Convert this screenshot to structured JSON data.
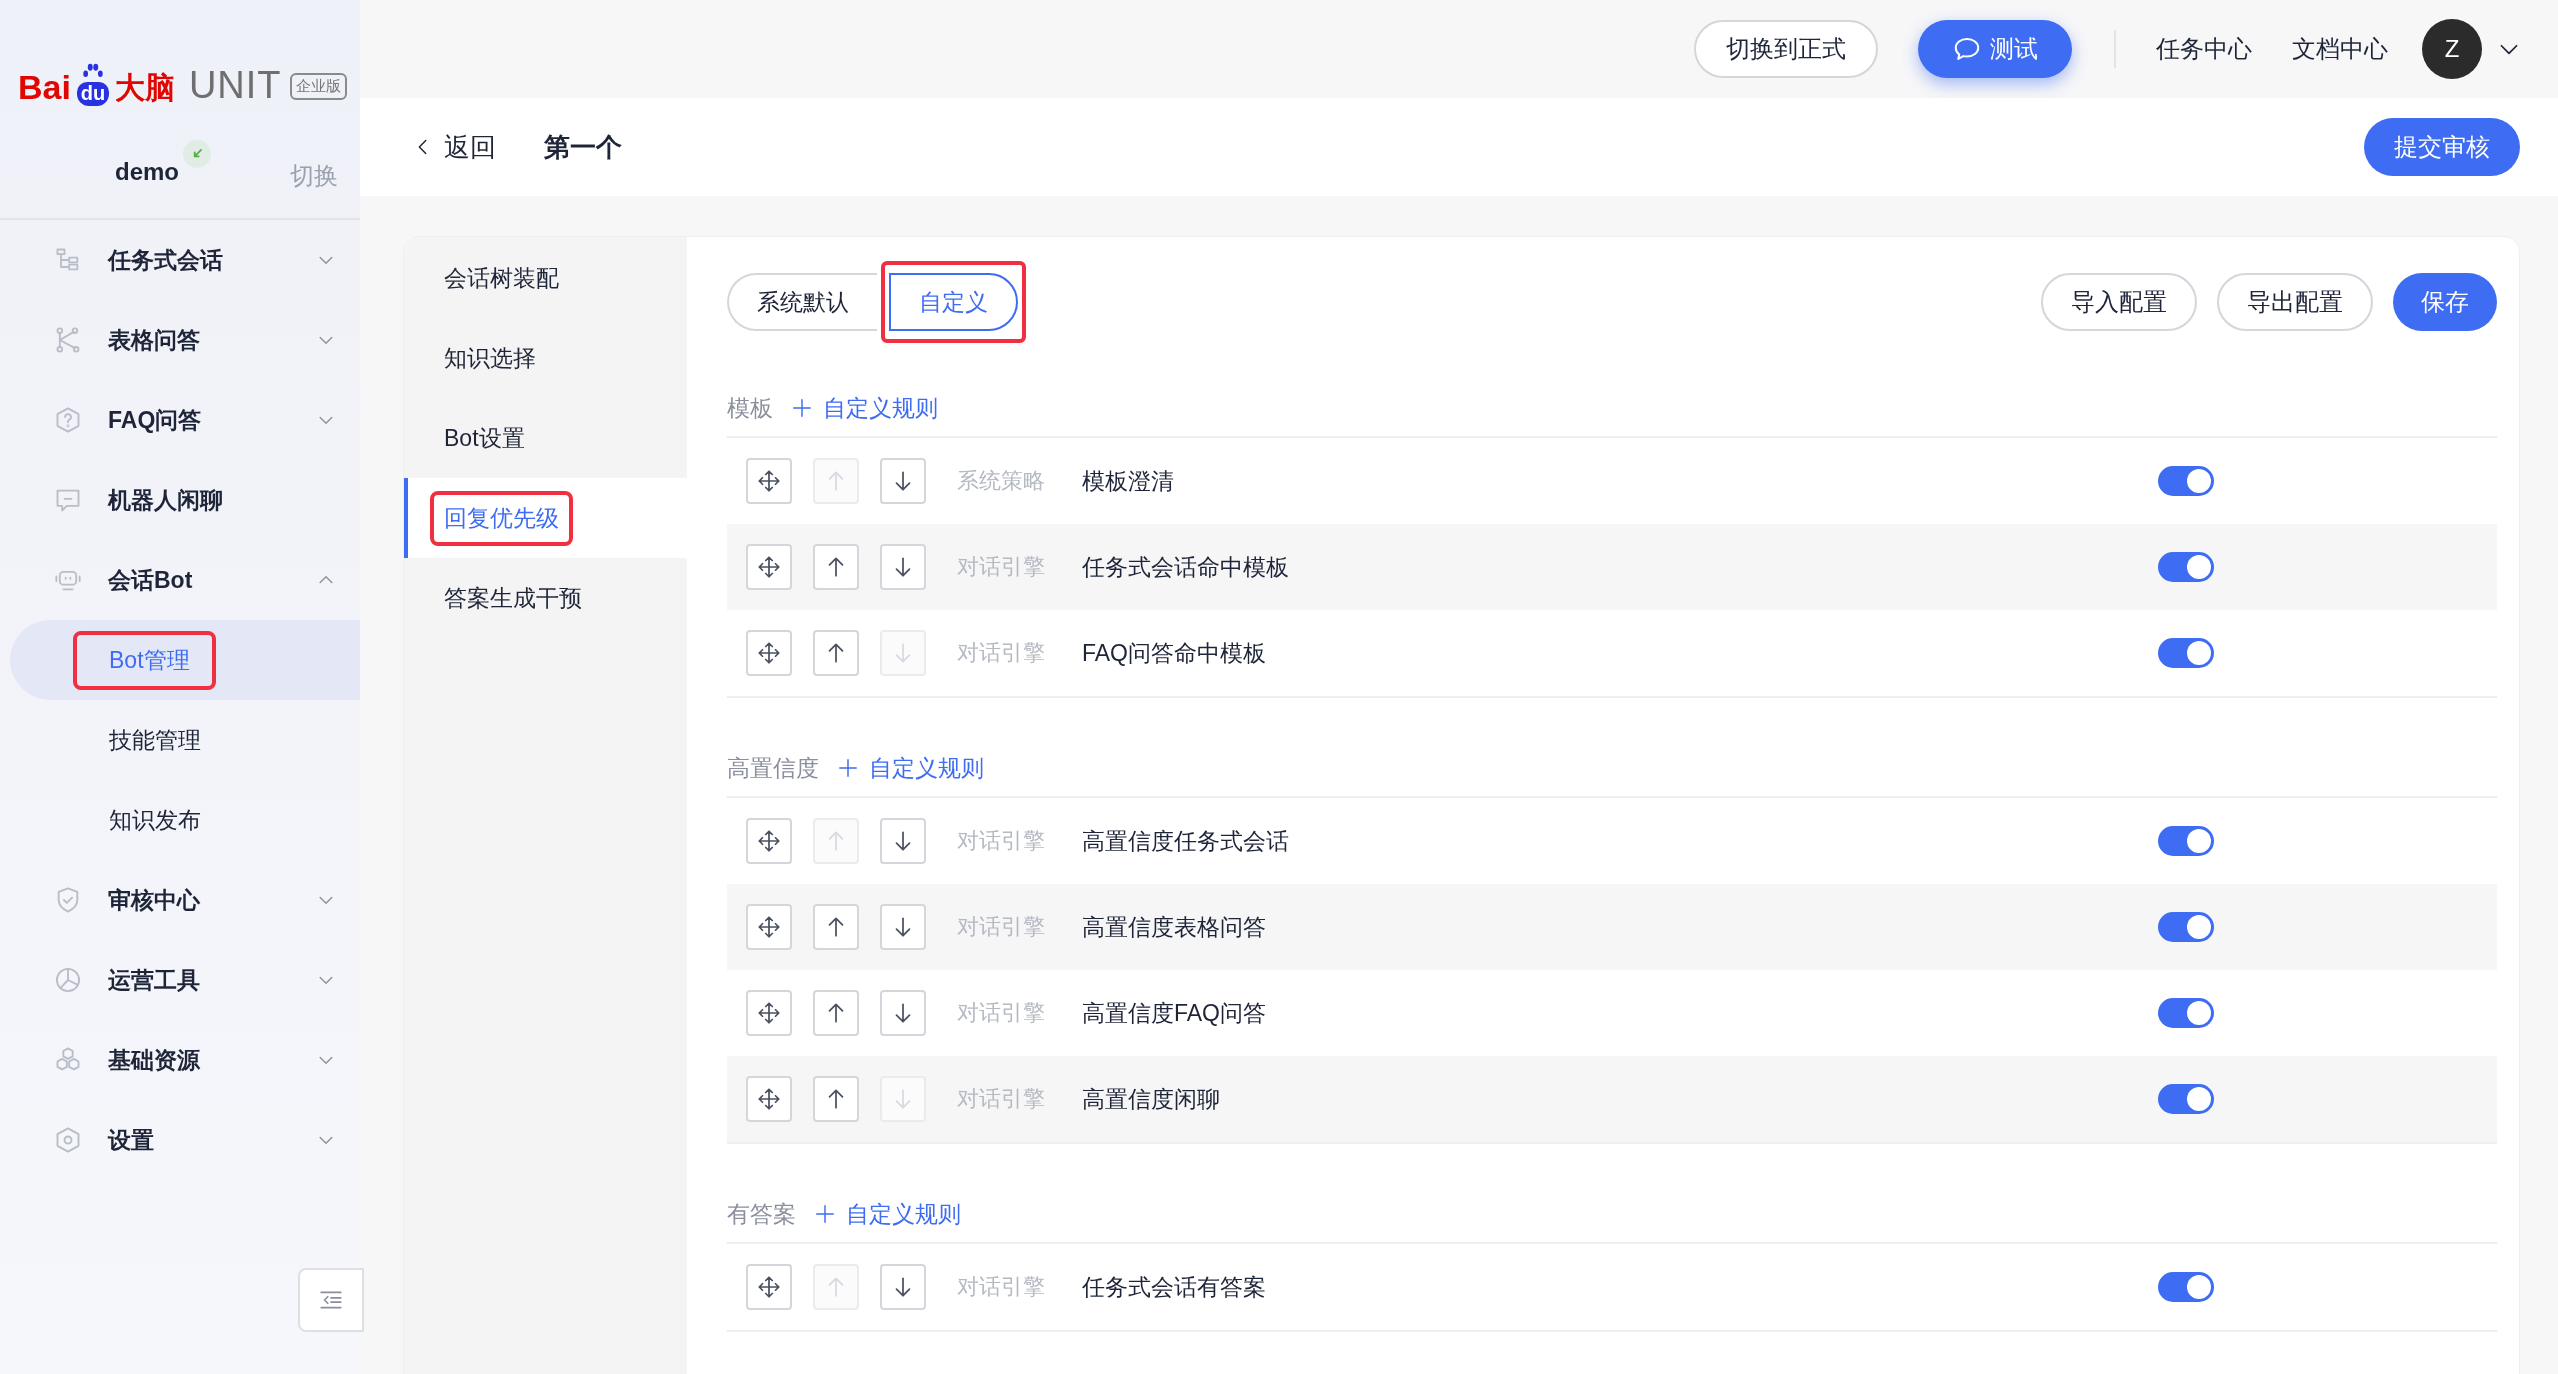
{
  "logo": {
    "brand": "Bai",
    "paw_text": "du",
    "product_cn": "大脑",
    "product": "UNIT",
    "edition": "企业版"
  },
  "account": {
    "name": "demo",
    "switch_label": "切换"
  },
  "sidebar": {
    "items": [
      {
        "label": "任务式会话",
        "expanded": false
      },
      {
        "label": "表格问答",
        "expanded": false
      },
      {
        "label": "FAQ问答",
        "expanded": false
      },
      {
        "label": "机器人闲聊"
      },
      {
        "label": "会话Bot",
        "expanded": true,
        "children": [
          {
            "label": "Bot管理",
            "selected": true,
            "highlighted": true
          },
          {
            "label": "技能管理",
            "selected": false,
            "highlighted": false
          },
          {
            "label": "知识发布",
            "selected": false,
            "highlighted": false
          }
        ]
      },
      {
        "label": "审核中心",
        "expanded": false
      },
      {
        "label": "运营工具",
        "expanded": false
      },
      {
        "label": "基础资源",
        "expanded": false
      },
      {
        "label": "设置",
        "expanded": false
      }
    ]
  },
  "topbar": {
    "switch_button": "切换到正式",
    "test_button": "测试",
    "links": [
      "任务中心",
      "文档中心"
    ],
    "avatar": "Z"
  },
  "header": {
    "back": "返回",
    "title": "第一个",
    "submit_button": "提交审核"
  },
  "settings_nav": [
    {
      "label": "会话树装配",
      "selected": false,
      "highlighted": false
    },
    {
      "label": "知识选择",
      "selected": false,
      "highlighted": false
    },
    {
      "label": "Bot设置",
      "selected": false,
      "highlighted": false
    },
    {
      "label": "回复优先级",
      "selected": true,
      "highlighted": true
    },
    {
      "label": "答案生成干预",
      "selected": false,
      "highlighted": false
    }
  ],
  "mode_tabs": [
    {
      "label": "系统默认",
      "selected": false,
      "highlighted": false
    },
    {
      "label": "自定义",
      "selected": true,
      "highlighted": true
    }
  ],
  "actions": [
    {
      "label": "导入配置",
      "kind": "outline"
    },
    {
      "label": "导出配置",
      "kind": "outline"
    },
    {
      "label": "保存",
      "kind": "primary"
    }
  ],
  "sections": [
    {
      "title": "模板",
      "add_label": "自定义规则",
      "rows": [
        {
          "category": "系统策略",
          "name": "模板澄清",
          "up_disabled": true,
          "down_disabled": false,
          "on": true
        },
        {
          "category": "对话引擎",
          "name": "任务式会话命中模板",
          "up_disabled": false,
          "down_disabled": false,
          "on": true
        },
        {
          "category": "对话引擎",
          "name": "FAQ问答命中模板",
          "up_disabled": false,
          "down_disabled": true,
          "on": true
        }
      ]
    },
    {
      "title": "高置信度",
      "add_label": "自定义规则",
      "rows": [
        {
          "category": "对话引擎",
          "name": "高置信度任务式会话",
          "up_disabled": true,
          "down_disabled": false,
          "on": true
        },
        {
          "category": "对话引擎",
          "name": "高置信度表格问答",
          "up_disabled": false,
          "down_disabled": false,
          "on": true
        },
        {
          "category": "对话引擎",
          "name": "高置信度FAQ问答",
          "up_disabled": false,
          "down_disabled": false,
          "on": true
        },
        {
          "category": "对话引擎",
          "name": "高置信度闲聊",
          "up_disabled": false,
          "down_disabled": true,
          "on": true
        }
      ]
    },
    {
      "title": "有答案",
      "add_label": "自定义规则",
      "rows": [
        {
          "category": "对话引擎",
          "name": "任务式会话有答案",
          "up_disabled": true,
          "down_disabled": false,
          "on": true
        }
      ]
    }
  ]
}
